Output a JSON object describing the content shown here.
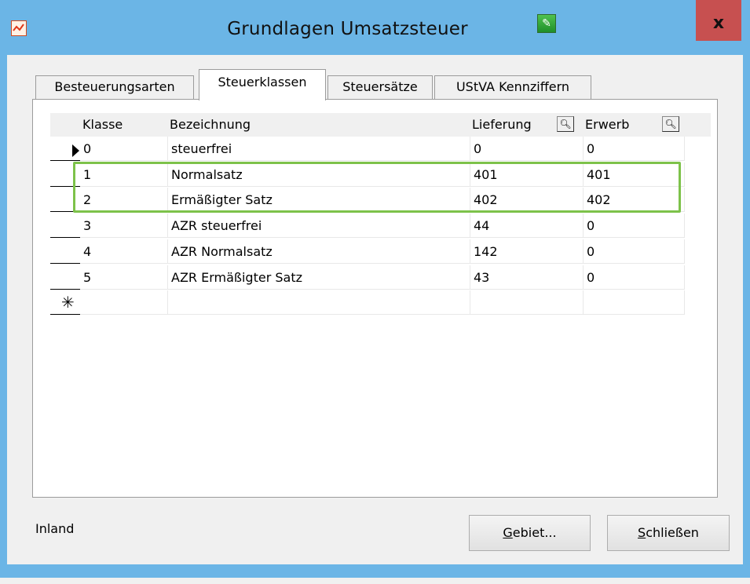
{
  "window": {
    "title": "Grundlagen Umsatzsteuer",
    "close_label": "x",
    "accent_color": "#6bb5e6"
  },
  "tabs": [
    {
      "label": "Besteuerungsarten"
    },
    {
      "label": "Steuerklassen"
    },
    {
      "label": "Steuersätze"
    },
    {
      "label": "UStVA Kennziffern"
    }
  ],
  "active_tab": "Steuerklassen",
  "grid": {
    "headers": {
      "klasse": "Klasse",
      "bezeichnung": "Bezeichnung",
      "lieferung": "Lieferung",
      "erwerb": "Erwerb"
    },
    "rows": [
      {
        "klasse": "0",
        "bezeichnung": "steuerfrei",
        "lieferung": "0",
        "erwerb": "0"
      },
      {
        "klasse": "1",
        "bezeichnung": "Normalsatz",
        "lieferung": "401",
        "erwerb": "401"
      },
      {
        "klasse": "2",
        "bezeichnung": "Ermäßigter Satz",
        "lieferung": "402",
        "erwerb": "402"
      },
      {
        "klasse": "3",
        "bezeichnung": "AZR steuerfrei",
        "lieferung": "44",
        "erwerb": "0"
      },
      {
        "klasse": "4",
        "bezeichnung": "AZR Normalsatz",
        "lieferung": "142",
        "erwerb": "0"
      },
      {
        "klasse": "5",
        "bezeichnung": "AZR Ermäßigter Satz",
        "lieferung": "43",
        "erwerb": "0"
      }
    ],
    "highlight_color": "#7dc24a"
  },
  "footer": {
    "status": "Inland",
    "gebiet_button": {
      "mnemonic": "G",
      "rest": "ebiet..."
    },
    "schliessen_button": {
      "mnemonic": "S",
      "rest": "chließen"
    }
  }
}
